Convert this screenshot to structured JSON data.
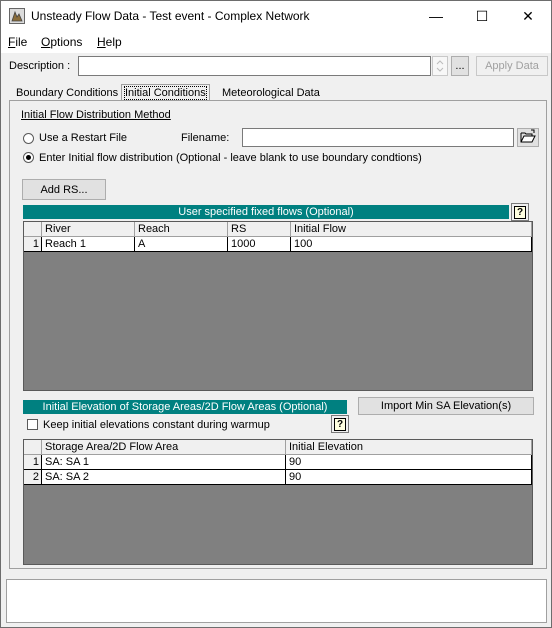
{
  "window": {
    "title": "Unsteady Flow Data - Test event - Complex Network",
    "minimize_glyph": "—",
    "maximize_glyph": "☐",
    "close_glyph": "✕"
  },
  "menu": [
    {
      "label": "File",
      "accel": "F",
      "rest": "ile"
    },
    {
      "label": "Options",
      "accel": "O",
      "rest": "ptions"
    },
    {
      "label": "Help",
      "accel": "H",
      "rest": "elp"
    }
  ],
  "description": {
    "label": "Description :",
    "value": "",
    "browse_label": "...",
    "apply_label": "Apply Data"
  },
  "tabs": [
    {
      "label": "Boundary Conditions",
      "active": false
    },
    {
      "label": "Initial Conditions",
      "active": true
    },
    {
      "label": "Meteorological Data",
      "active": false
    }
  ],
  "initial_conditions": {
    "method_heading": "Initial Flow Distribution Method",
    "restart_option": "Use a Restart File",
    "filename_label": "Filename:",
    "filename_value": "",
    "enter_option": "Enter Initial flow distribution (Optional - leave blank to use boundary condtions)",
    "selected_option": "enter",
    "add_rs_label": "Add RS...",
    "fixed_flows": {
      "title": "User specified fixed flows (Optional)",
      "columns": [
        "River",
        "Reach",
        "RS",
        "Initial Flow"
      ],
      "rows": [
        {
          "num": "1",
          "river": "Reach 1",
          "reach": "A",
          "rs": "1000",
          "flow": "100"
        }
      ]
    },
    "storage": {
      "title": "Initial Elevation of Storage Areas/2D Flow Areas (Optional)",
      "import_label": "Import Min SA Elevation(s)",
      "keep_constant_label": "Keep initial elevations constant during warmup",
      "keep_constant_checked": false,
      "columns": [
        "Storage Area/2D Flow Area",
        "Initial Elevation"
      ],
      "rows": [
        {
          "num": "1",
          "area": "SA: SA 1",
          "elev": "90"
        },
        {
          "num": "2",
          "area": "SA: SA 2",
          "elev": "90"
        }
      ]
    },
    "help_glyph": "?"
  },
  "colors": {
    "teal": "#008080",
    "grid_bg": "#808080"
  }
}
